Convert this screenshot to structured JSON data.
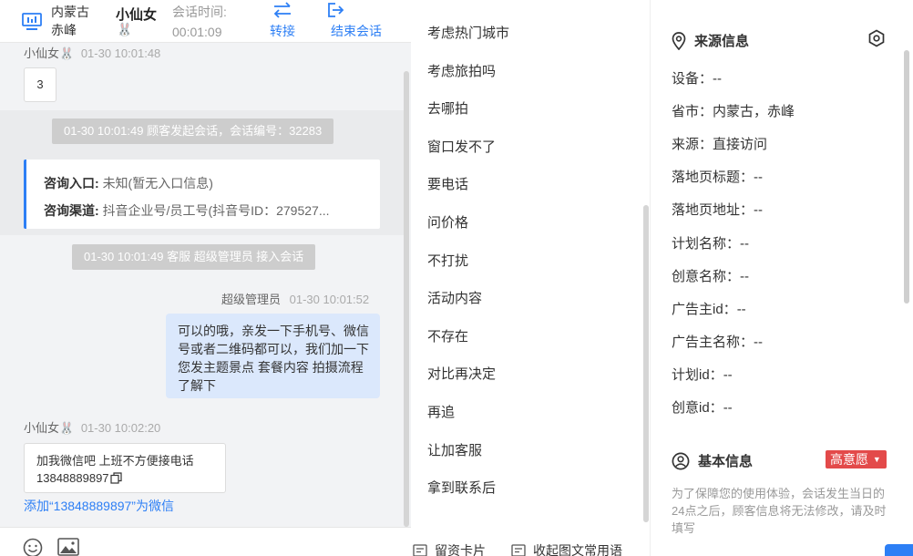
{
  "header": {
    "location_line1": "内蒙古",
    "location_line2": "赤峰",
    "user_name": "小仙女",
    "user_emoji": "🐰",
    "session_time_label": "会话时间:",
    "session_time_value": "00:01:09",
    "transfer_label": "转接",
    "end_label": "结束会话",
    "accent": "#2d7ff5"
  },
  "chat": {
    "msg1": {
      "sender": "小仙女🐰",
      "time": "01-30 10:01:48",
      "content": "3"
    },
    "system1": "01-30 10:01:49 顾客发起会话，会话编号：32283",
    "info_card": {
      "entry_label": "咨询入口:",
      "entry_value": "未知(暂无入口信息)",
      "channel_label": "咨询渠道:",
      "channel_value": "抖音企业号/员工号(抖音号ID：279527..."
    },
    "system2": "01-30 10:01:49 客服 超级管理员 接入会话",
    "msg2": {
      "sender": "超级管理员",
      "time": "01-30 10:01:52",
      "content": "可以的哦，亲发一下手机号、微信号或者二维码都可以，我们加一下您发主题景点 套餐内容 拍摄流程了解下"
    },
    "msg3": {
      "sender": "小仙女🐰",
      "time": "01-30 10:02:20",
      "content_line1": "加我微信吧 上班不方便接电话",
      "content_line2": "13848889897"
    },
    "add_wechat_link": "添加“13848889897”为微信"
  },
  "phrases": {
    "items": [
      "考虑热门城市",
      "考虑旅拍吗",
      "去哪拍",
      "窗口发不了",
      "要电话",
      "问价格",
      "不打扰",
      "活动内容",
      "不存在",
      "对比再决定",
      "再追",
      "让加客服",
      "拿到联系后"
    ],
    "footer_card": "留资卡片",
    "footer_collapse": "收起图文常用语"
  },
  "info": {
    "source_title": "来源信息",
    "fields": [
      {
        "label": "设备：",
        "value": "--"
      },
      {
        "label": "省市：",
        "value": "内蒙古，赤峰"
      },
      {
        "label": "来源：",
        "value": "直接访问"
      },
      {
        "label": "落地页标题：",
        "value": "--"
      },
      {
        "label": "落地页地址：",
        "value": "--"
      },
      {
        "label": "计划名称：",
        "value": "--"
      },
      {
        "label": "创意名称：",
        "value": "--"
      },
      {
        "label": "广告主id：",
        "value": "--"
      },
      {
        "label": "广告主名称：",
        "value": "--"
      },
      {
        "label": "计划id：",
        "value": "--"
      },
      {
        "label": "创意id：",
        "value": "--"
      }
    ],
    "basic_title": "基本信息",
    "intent_badge": "高意愿",
    "intent_color": "#e34a4a",
    "notice": "为了保障您的使用体验，会话发生当日的24点之后，顾客信息将无法修改，请及时填写"
  }
}
